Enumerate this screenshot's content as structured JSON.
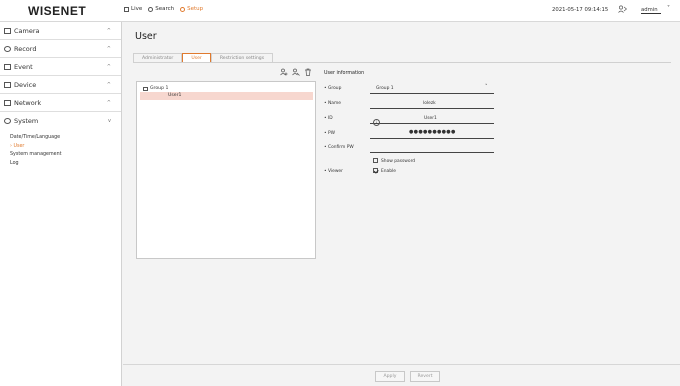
{
  "topbar": {
    "logo": "WISENET",
    "nav": [
      {
        "label": "Live",
        "icon": "monitor-icon"
      },
      {
        "label": "Search",
        "icon": "search-icon"
      },
      {
        "label": "Setup",
        "icon": "gear-icon",
        "active": true
      }
    ],
    "datetime": "2021-05-17 09:14:15",
    "user": "admin"
  },
  "sidebar": {
    "items": [
      {
        "label": "Camera",
        "icon": "camera-icon"
      },
      {
        "label": "Record",
        "icon": "record-icon"
      },
      {
        "label": "Event",
        "icon": "event-icon"
      },
      {
        "label": "Device",
        "icon": "device-icon"
      },
      {
        "label": "Network",
        "icon": "network-icon"
      },
      {
        "label": "System",
        "icon": "system-icon",
        "expanded": true
      }
    ],
    "submenu": [
      "Date/Time/Language",
      "User",
      "System management",
      "Log"
    ],
    "active_sub": "User"
  },
  "main": {
    "title": "User",
    "tabs": [
      "Administrator",
      "User",
      "Restriction settings"
    ],
    "active_tab": "User",
    "tree": {
      "group": "Group 1",
      "user": "User1"
    },
    "user_info": {
      "header": "User information",
      "group_label": "Group",
      "group_value": "Group 1",
      "name_label": "Name",
      "name_value": "lolezk",
      "id_label": "ID",
      "id_value": "User1",
      "pw_label": "PW",
      "pw_value": "●●●●●●●●●●",
      "confirm_label": "Confirm PW",
      "show_password": "Show password",
      "viewer_label": "Viewer",
      "viewer_value": "Enable"
    },
    "buttons": {
      "apply": "Apply",
      "revert": "Revert"
    }
  },
  "colors": {
    "accent": "#e07a2e",
    "selected_row": "#f7d7cf"
  }
}
